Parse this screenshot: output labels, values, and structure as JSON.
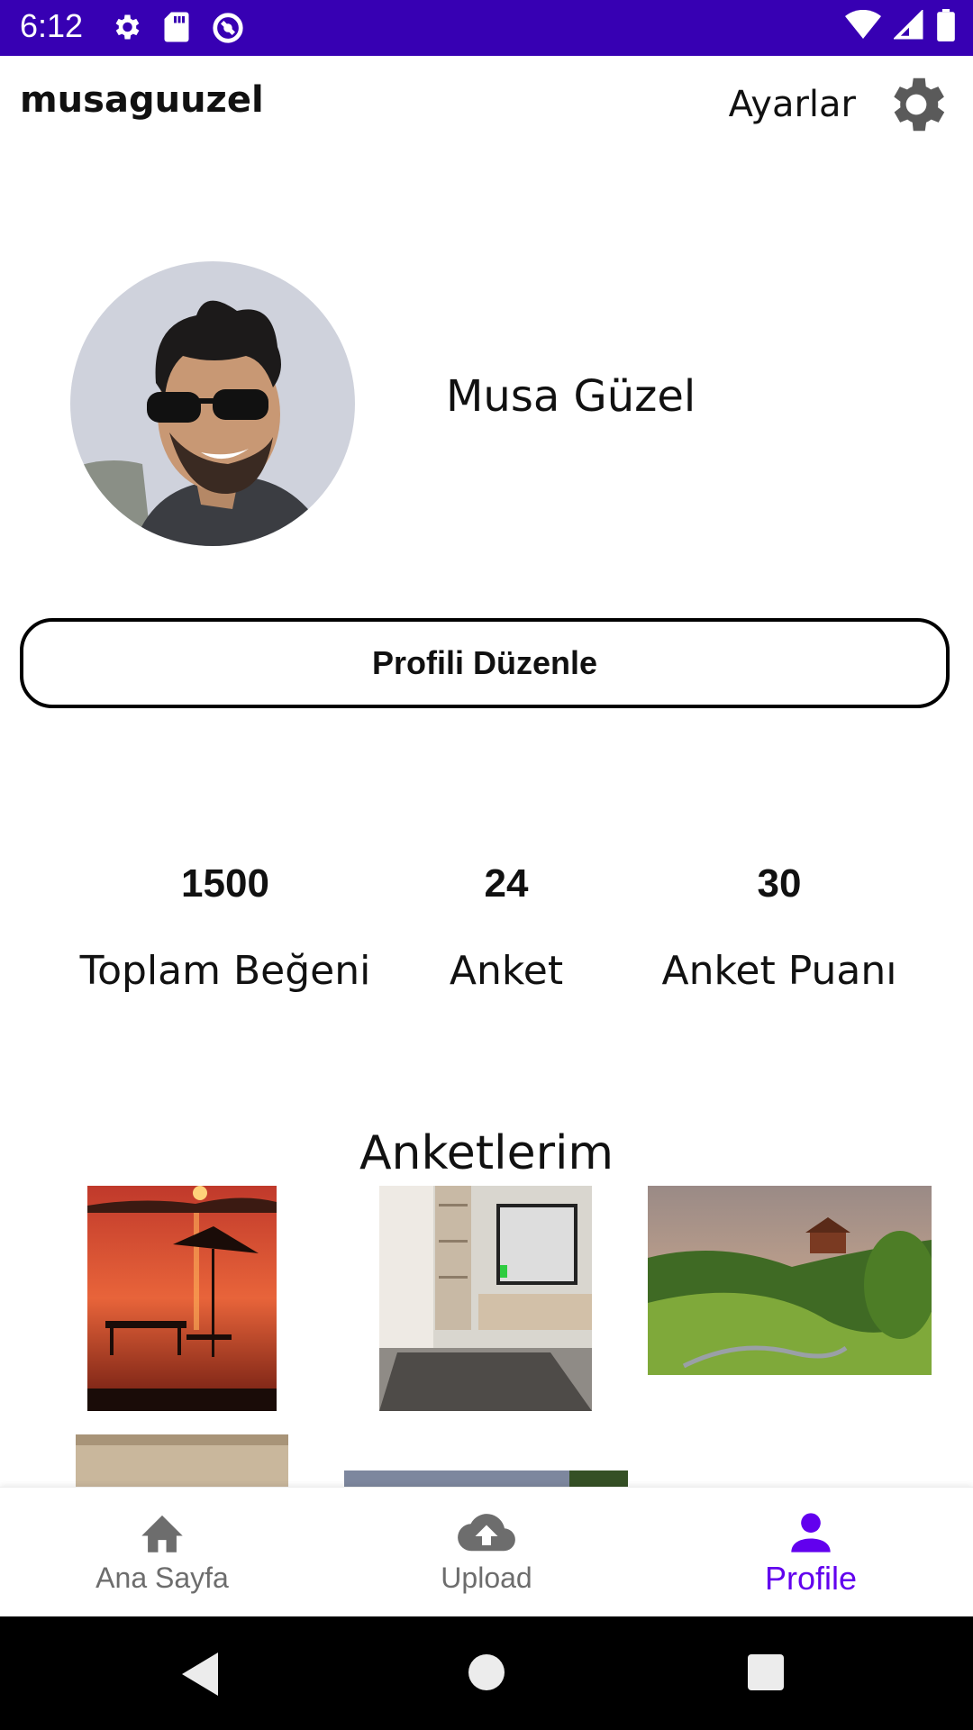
{
  "status_bar": {
    "time": "6:12",
    "left_icons": [
      "gear-icon",
      "sd-card-icon",
      "sync-icon"
    ],
    "right_icons": [
      "wifi-icon",
      "signal-icon",
      "battery-icon"
    ],
    "background": "#3700b3"
  },
  "header": {
    "username": "musaguuzel",
    "settings_label": "Ayarlar"
  },
  "profile": {
    "full_name": "Musa Güzel",
    "edit_button_label": "Profili Düzenle"
  },
  "stats": [
    {
      "value": "1500",
      "label": "Toplam Beğeni"
    },
    {
      "value": "24",
      "label": "Anket"
    },
    {
      "value": "30",
      "label": "Anket Puanı"
    }
  ],
  "section": {
    "title": "Anketlerim"
  },
  "bottom_nav": {
    "items": [
      {
        "label": "Ana Sayfa",
        "icon": "home-icon",
        "active": false
      },
      {
        "label": "Upload",
        "icon": "cloud-upload-icon",
        "active": false
      },
      {
        "label": "Profile",
        "icon": "person-icon",
        "active": true
      }
    ],
    "active_color": "#6200ee",
    "inactive_color": "#6d6d6d"
  },
  "system_nav": {
    "buttons": [
      "back-icon",
      "home-circle-icon",
      "recents-icon"
    ]
  }
}
